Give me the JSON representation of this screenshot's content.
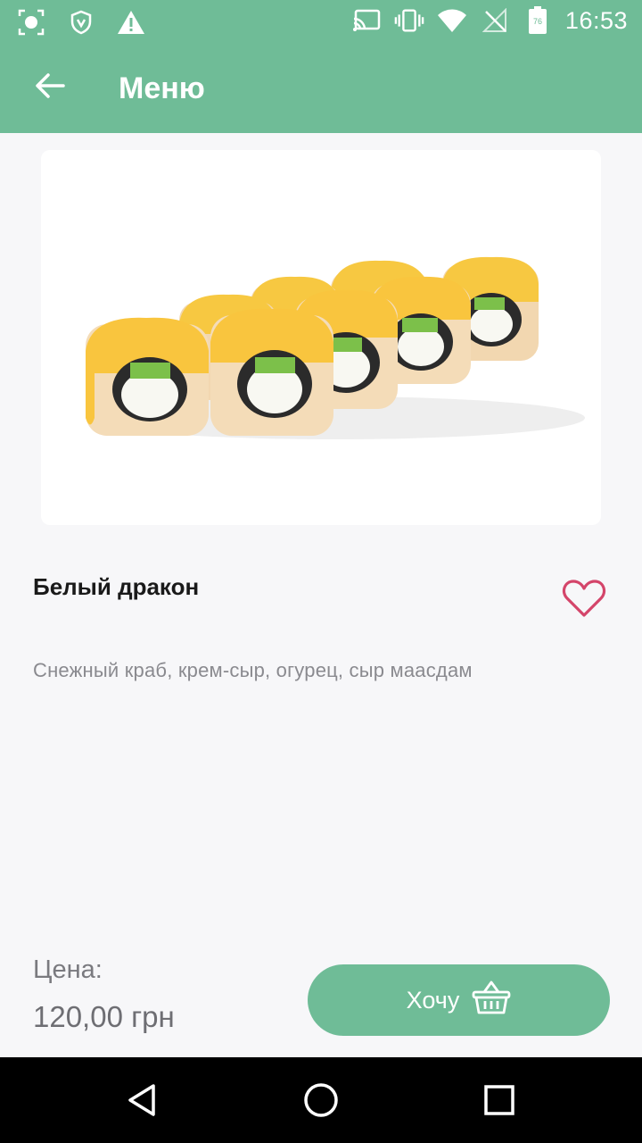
{
  "status_bar": {
    "time": "16:53",
    "left_icons": [
      "screenshot-icon",
      "vpn-shield-icon",
      "warning-icon"
    ],
    "right_icons": [
      "cast-icon",
      "vibrate-icon",
      "wifi-icon",
      "no-signal-icon",
      "battery-icon"
    ],
    "battery_level": "76"
  },
  "app_bar": {
    "title": "Меню",
    "back_icon": "arrow-left-icon"
  },
  "product": {
    "image_alt": "sushi-rolls-image",
    "name": "Белый дракон",
    "description": "Снежный краб, крем-сыр, огурец, сыр маасдам",
    "favorite_icon": "heart-outline-icon"
  },
  "price": {
    "label": "Цена:",
    "value": "120,00 грн"
  },
  "actions": {
    "want_label": "Хочу",
    "want_icon": "basket-icon"
  },
  "navigation": {
    "back_icon": "triangle-back-icon",
    "home_icon": "circle-home-icon",
    "recents_icon": "square-recents-icon"
  },
  "colors": {
    "primary": "#6fbc97",
    "heart": "#d4456a",
    "background": "#f7f7f9"
  }
}
